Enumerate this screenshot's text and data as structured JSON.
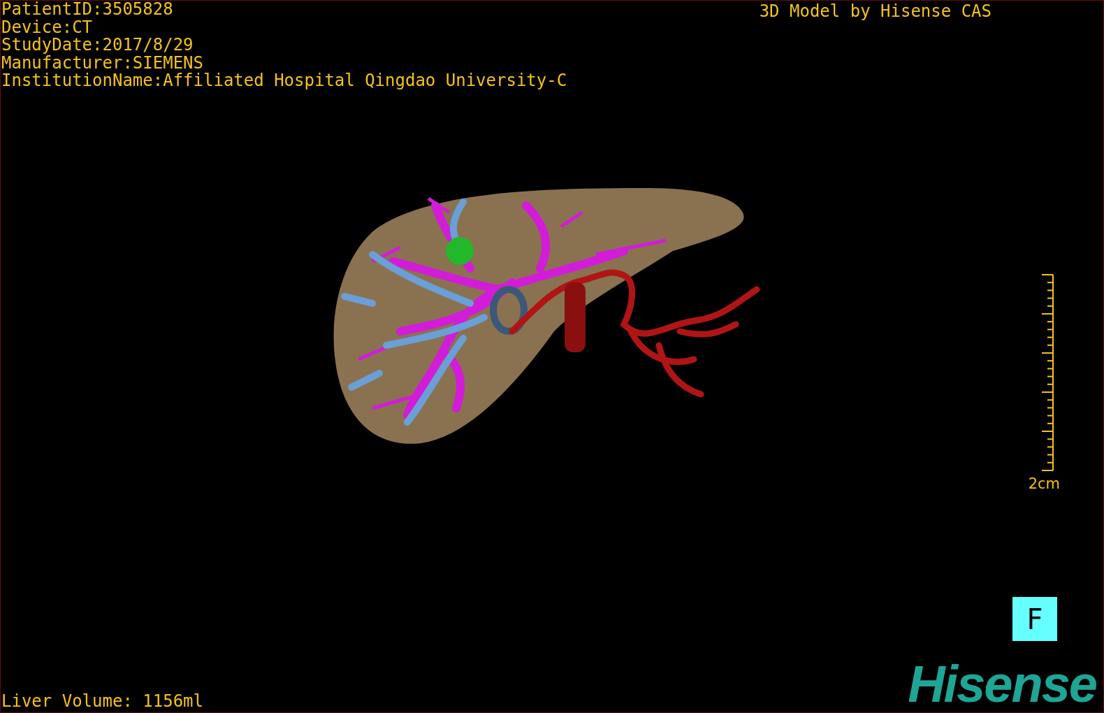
{
  "study_info": [
    "PatientID:3505828",
    "Device:CT",
    "StudyDate:2017/8/29",
    "Manufacturer:SIEMENS",
    "InstitutionName:Affiliated Hospital Qingdao University-C"
  ],
  "title": "3D Model by Hisense CAS",
  "scale_bar": {
    "label": "2cm"
  },
  "orientation_button": {
    "label": "F"
  },
  "liver_volume": "Liver Volume: 1156ml",
  "logo": "Hisense"
}
